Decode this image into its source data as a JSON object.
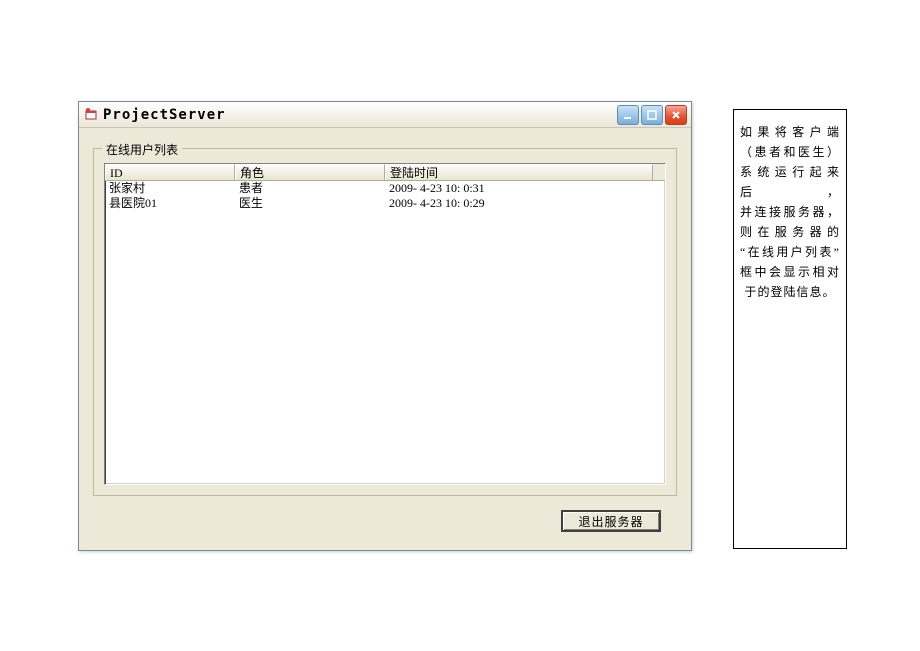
{
  "window": {
    "title": "ProjectServer"
  },
  "groupbox": {
    "title": "在线用户列表"
  },
  "listview": {
    "columns": {
      "id": "ID",
      "role": "角色",
      "time": "登陆时间"
    },
    "rows": [
      {
        "id": "张家村",
        "role": "患者",
        "time": "2009- 4-23 10: 0:31"
      },
      {
        "id": "县医院01",
        "role": "医生",
        "time": "2009- 4-23 10: 0:29"
      }
    ]
  },
  "buttons": {
    "exit": "退出服务器"
  },
  "note": {
    "l1": "如果将客户端",
    "l2": "（患者和医生）",
    "l3": "系统运行起来后，",
    "l4": "并连接服务器，",
    "l5": "则在服务器的",
    "l6": "“在线用户列表”",
    "l7": "框中会显示相对",
    "l8": "于的登陆信息。"
  }
}
